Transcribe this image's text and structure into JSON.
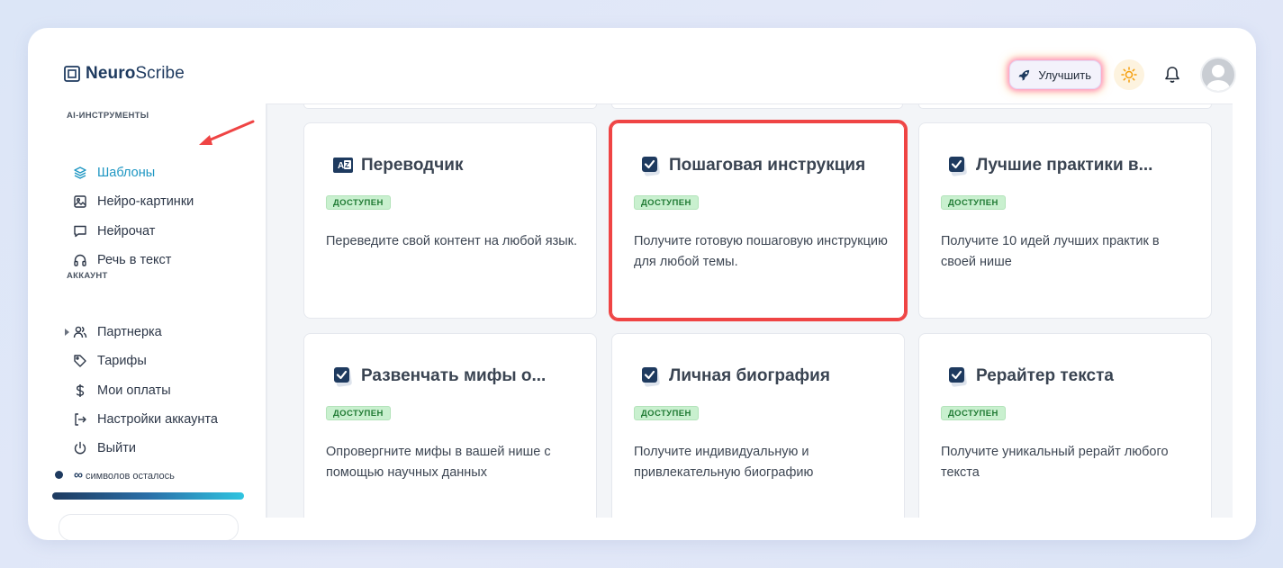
{
  "app": {
    "logo_bold": "Neuro",
    "logo_light": "Scribe"
  },
  "header": {
    "upgrade_label": "Улучшить"
  },
  "sidebar": {
    "section_ai": "AI-ИНСТРУМЕНТЫ",
    "ai_items": [
      {
        "label": "Шаблоны",
        "icon": "layers-icon",
        "active": true
      },
      {
        "label": "Нейро-картинки",
        "icon": "image-icon"
      },
      {
        "label": "Нейрочат",
        "icon": "chat-icon"
      },
      {
        "label": "Речь в текст",
        "icon": "headphones-icon"
      }
    ],
    "section_account": "АККАУНТ",
    "account_items": [
      {
        "label": "Партнерка",
        "icon": "users-icon"
      },
      {
        "label": "Тарифы",
        "icon": "tag-icon"
      },
      {
        "label": "Мои оплаты",
        "icon": "dollar-icon"
      },
      {
        "label": "Настройки аккаунта",
        "icon": "login-icon"
      },
      {
        "label": "Выйти",
        "icon": "power-icon"
      }
    ],
    "credits_symbol": "∞",
    "credits_label": "символов осталось",
    "credits_fraction": 1.0
  },
  "cards": [
    {
      "title": "Переводчик",
      "badge": "ДОСТУПЕН",
      "desc": "Переведите свой контент на любой язык.",
      "icon": "translate-icon"
    },
    {
      "title": "Пошаговая инструкция",
      "badge": "ДОСТУПЕН",
      "desc": "Получите готовую пошаговую инструкцию для любой темы.",
      "icon": "checkbox-icon",
      "highlighted": true
    },
    {
      "title": "Лучшие практики в...",
      "badge": "ДОСТУПЕН",
      "desc": "Получите 10 идей лучших практик в своей нише",
      "icon": "checkbox-icon"
    },
    {
      "title": "Развенчать мифы о...",
      "badge": "ДОСТУПЕН",
      "desc": "Опровергните мифы в вашей нише с помощью научных данных",
      "icon": "checkbox-icon"
    },
    {
      "title": "Личная биография",
      "badge": "ДОСТУПЕН",
      "desc": "Получите индивидуальную и привлекательную биографию",
      "icon": "checkbox-icon"
    },
    {
      "title": "Рерайтер текста",
      "badge": "ДОСТУПЕН",
      "desc": "Получите уникальный рерайт любого текста",
      "icon": "checkbox-icon"
    }
  ],
  "colors": {
    "accent": "#1f97c3",
    "brand": "#1e3a5f",
    "highlight": "#ef4444",
    "badge_bg": "#c9f0cf"
  }
}
